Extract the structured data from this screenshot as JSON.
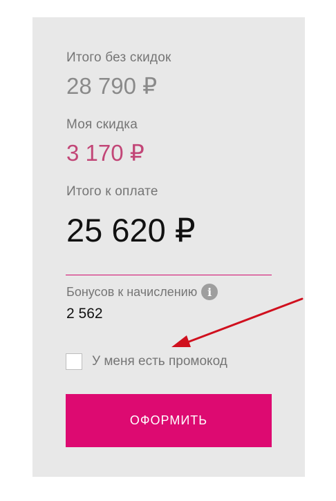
{
  "summary": {
    "subtotal_label": "Итого без скидок",
    "subtotal_value": "28 790 ₽",
    "discount_label": "Моя скидка",
    "discount_value": "3 170 ₽",
    "total_label": "Итого к оплате",
    "total_value": "25 620 ₽"
  },
  "bonus": {
    "label": "Бонусов к начислению",
    "info_icon": "i",
    "value": "2 562"
  },
  "promo": {
    "label": "У меня есть промокод",
    "checked": false
  },
  "submit_button": {
    "label": "ОФОРМИТЬ"
  },
  "colors": {
    "accent": "#dd0a71",
    "discount": "#c24677",
    "panel": "#e8e8e8",
    "annotation_arrow": "#d0101e"
  }
}
